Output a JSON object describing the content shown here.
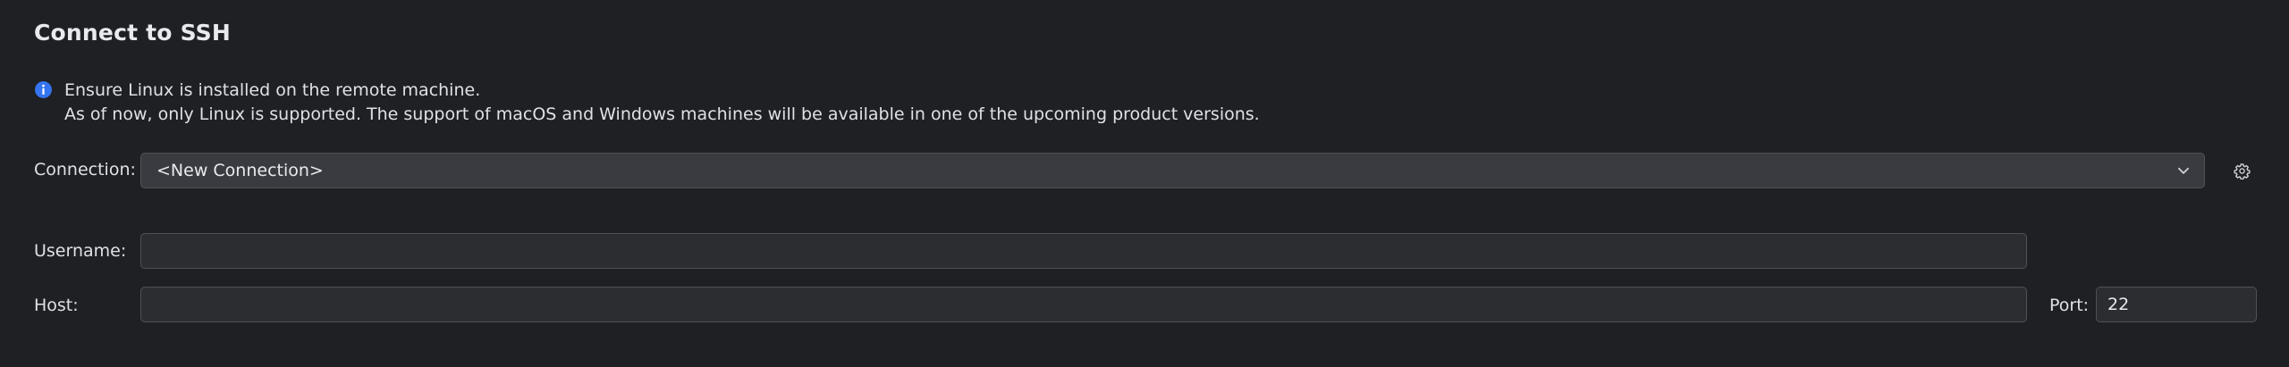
{
  "dialog": {
    "title": "Connect to SSH"
  },
  "info": {
    "icon": "info-icon",
    "line1": "Ensure Linux is installed on the remote machine.",
    "line2": "As of now, only Linux is supported. The support of macOS and Windows machines will be available in one of the upcoming product versions."
  },
  "connection": {
    "label": "Connection:",
    "selected": "<New Connection>",
    "icons": [
      "chevron-down-icon",
      "gear-icon"
    ]
  },
  "username": {
    "label": "Username:",
    "value": ""
  },
  "host": {
    "label": "Host:",
    "value": ""
  },
  "port": {
    "label": "Port:",
    "value": "22"
  },
  "colors": {
    "background": "#1f2024",
    "field": "#2b2d30",
    "combo": "#393b40",
    "border": "#4e5157",
    "info_accent": "#3574f0"
  }
}
